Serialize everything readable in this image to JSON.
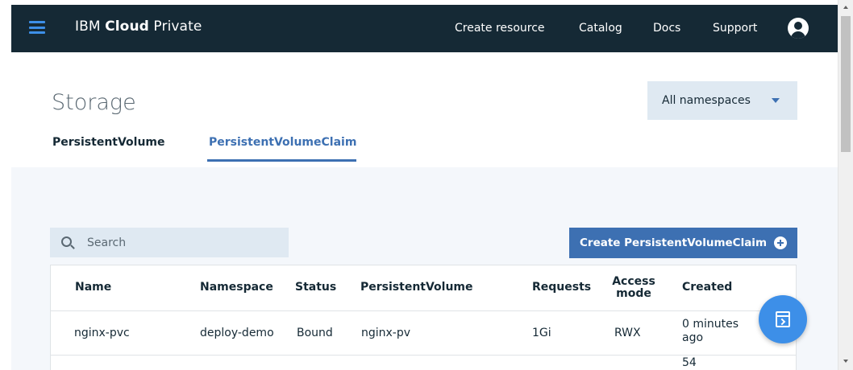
{
  "navbar": {
    "brand_prefix": "IBM ",
    "brand_bold": "Cloud",
    "brand_suffix": " Private",
    "links": [
      "Create resource",
      "Catalog",
      "Docs",
      "Support"
    ],
    "colors": {
      "background": "#152935",
      "hamburger": "#3d8fe8"
    },
    "icons": {
      "menu": "hamburger-icon",
      "user": "user-avatar-icon"
    }
  },
  "page": {
    "title": "Storage",
    "namespace_selector": "All namespaces",
    "tabs": [
      {
        "label": "PersistentVolume",
        "active": false
      },
      {
        "label": "PersistentVolumeClaim",
        "active": true
      }
    ]
  },
  "toolbar": {
    "search_placeholder": "Search",
    "create_button": "Create PersistentVolumeClaim",
    "accent_color": "#3d70b2"
  },
  "table": {
    "columns": [
      "Name",
      "Namespace",
      "Status",
      "PersistentVolume",
      "Requests",
      "Access mode",
      "Created"
    ],
    "rows": [
      {
        "name": "nginx-pvc",
        "namespace": "deploy-demo",
        "status": "Bound",
        "persistent_volume": "nginx-pv",
        "requests": "1Gi",
        "access_mode": "RWX",
        "created": "0 minutes ago"
      }
    ],
    "partial_row_text": "54"
  },
  "fab": {
    "icon": "terminal-icon"
  }
}
